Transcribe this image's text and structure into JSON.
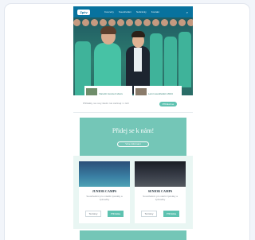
{
  "colors": {
    "brand_blue": "#08729e",
    "teal": "#74c6b7",
    "button_teal": "#5ec2b0"
  },
  "header": {
    "logo": "Zpěv",
    "nav": [
      "Koncerty",
      "Soustředění",
      "Nahrávky",
      "Kontakt"
    ],
    "search_icon": "search-icon"
  },
  "hero": {
    "teasers": [
      {
        "text": "Vánoční koncert sboru"
      },
      {
        "text": "Letní soustředění 2024"
      }
    ]
  },
  "strip": {
    "text": "Přihlášky na nový školní rok\nzačínají 1. září",
    "button": "Přihlásit se"
  },
  "band": {
    "title": "Přidej se k nám!",
    "button": "Více informací"
  },
  "camps": [
    {
      "title": "JUNIOR CAMPS",
      "desc": "Soustředění pro mladší zpěváky a zpěvačky",
      "button_a": "Termíny",
      "button_b": "Přihláška"
    },
    {
      "title": "SENIOR CAMPS",
      "desc": "Soustředění pro starší zpěváky a zpěvačky",
      "button_a": "Termíny",
      "button_b": "Přihláška"
    }
  ]
}
